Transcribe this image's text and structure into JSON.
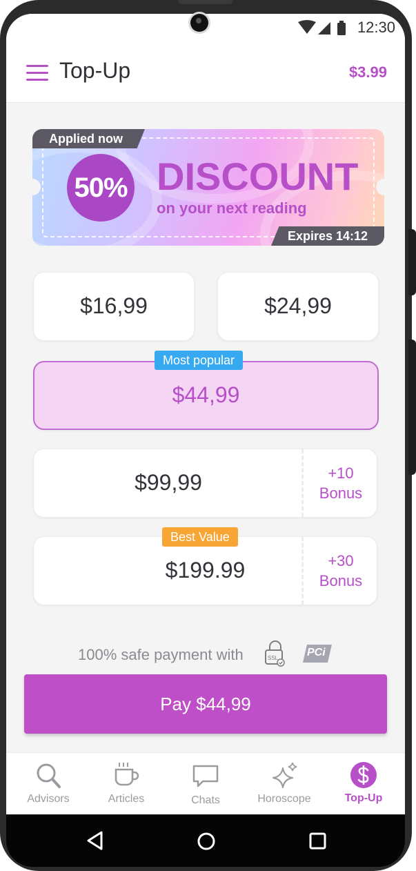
{
  "status": {
    "time": "12:30"
  },
  "header": {
    "title": "Top-Up",
    "balance": "$3.99"
  },
  "banner": {
    "applied": "Applied now",
    "percent": "50%",
    "title": "DISCOUNT",
    "subtitle": "on your next reading",
    "expires": "Expires 14:12"
  },
  "packages": {
    "p1": "$16,99",
    "p2": "$24,99",
    "popular_tag": "Most popular",
    "p3": "$44,99",
    "p4": "$99,99",
    "p4_bonus_amount": "+10",
    "p4_bonus_label": "Bonus",
    "best_tag": "Best Value",
    "p5": "$199.99",
    "p5_bonus_amount": "+30",
    "p5_bonus_label": "Bonus"
  },
  "safe_payment": {
    "text": "100% safe payment with",
    "ssl_icon": "ssl-lock-icon",
    "pci_icon": "pci-icon",
    "pci_text": "PCi"
  },
  "pay_button": "Pay $44,99",
  "tabs": [
    {
      "label": "Advisors",
      "icon": "search-icon"
    },
    {
      "label": "Articles",
      "icon": "cup-icon"
    },
    {
      "label": "Chats",
      "icon": "chat-icon"
    },
    {
      "label": "Horoscope",
      "icon": "sparkle-icon"
    },
    {
      "label": "Top-Up",
      "icon": "dollar-icon",
      "active": true
    }
  ],
  "colors": {
    "accent": "#b64fc8",
    "popular_bg": "#f5d5f4",
    "tag_blue": "#36a9f0",
    "tag_orange": "#f7a535"
  }
}
